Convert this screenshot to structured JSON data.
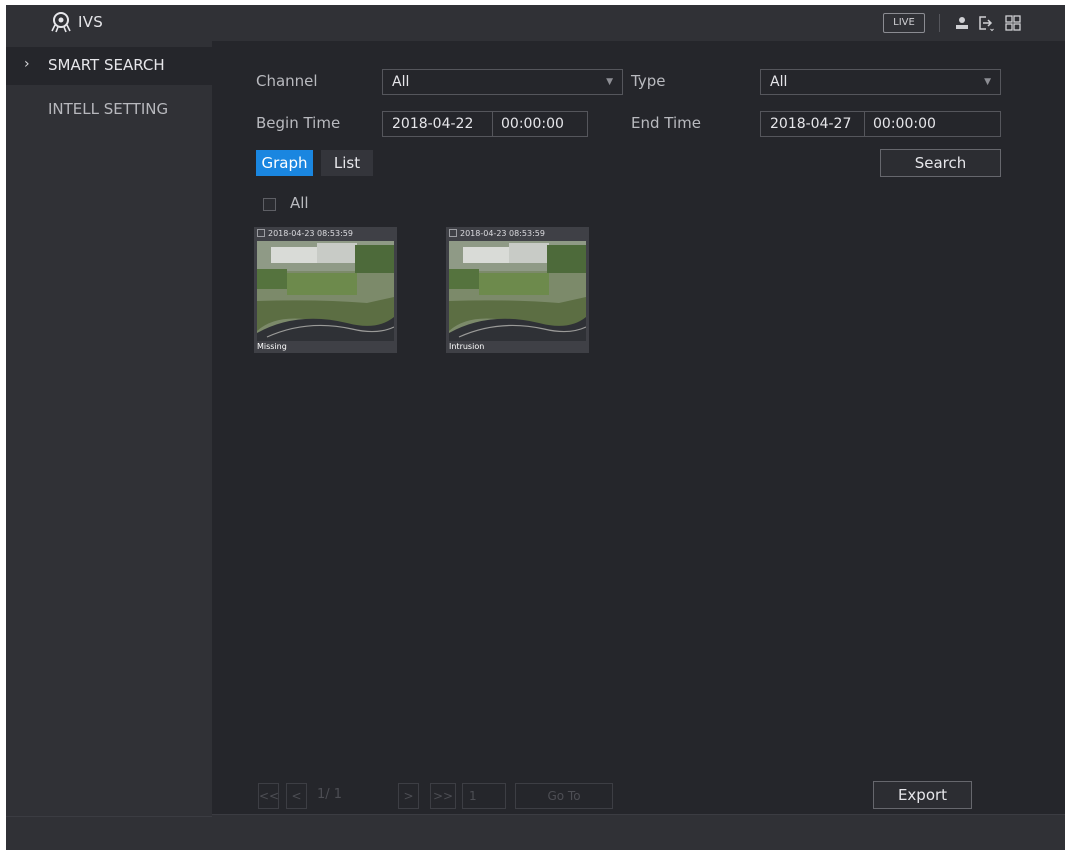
{
  "app": {
    "title": "IVS"
  },
  "topbar": {
    "live_label": "LIVE",
    "icons": [
      "user-icon",
      "logout-icon",
      "grid-icon"
    ]
  },
  "sidebar": {
    "items": [
      {
        "label": "SMART SEARCH",
        "active": true
      },
      {
        "label": "INTELL SETTING",
        "active": false
      }
    ]
  },
  "form": {
    "channel_label": "Channel",
    "channel_value": "All",
    "type_label": "Type",
    "type_value": "All",
    "begin_label": "Begin Time",
    "begin_date": "2018-04-22",
    "begin_time": "00:00:00",
    "end_label": "End Time",
    "end_date": "2018-04-27",
    "end_time": "00:00:00"
  },
  "view_tabs": [
    {
      "label": "Graph",
      "active": true
    },
    {
      "label": "List",
      "active": false
    }
  ],
  "search_label": "Search",
  "select_all_label": "All",
  "results": [
    {
      "timestamp": "2018-04-23 08:53:59",
      "event": "Missing"
    },
    {
      "timestamp": "2018-04-23 08:53:59",
      "event": "Intrusion"
    }
  ],
  "pagination": {
    "first": "<<",
    "prev": "<",
    "page_status": "1/ 1",
    "next": ">",
    "last": ">>",
    "page_input": "1",
    "goto_label": "Go To"
  },
  "export_label": "Export",
  "colors": {
    "accent": "#1a86e0",
    "background": "#25262b",
    "panel": "#303136"
  }
}
